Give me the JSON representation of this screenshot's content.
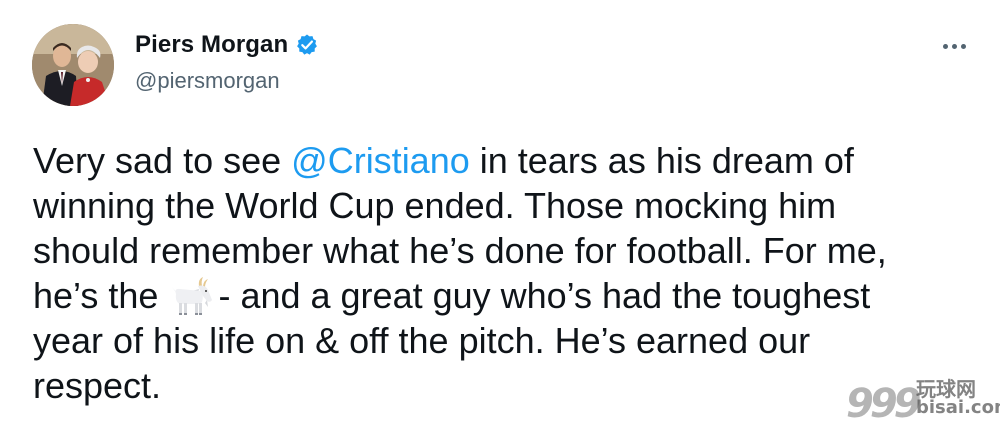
{
  "tweet": {
    "author": {
      "display_name": "Piers Morgan",
      "handle": "@piersmorgan",
      "verified_color": "#1d9bf0"
    },
    "more_icon": "more-horizontal-icon",
    "text_lines": [
      {
        "before": "Very sad to see ",
        "mention": "@Cristiano",
        "after": " in tears as his dream of"
      },
      {
        "text": "winning the World Cup ended. Those mocking him"
      },
      {
        "text": "should remember what he’s done for football. For me,"
      },
      {
        "before": "he’s the ",
        "emoji": "goat-emoji",
        "after": "- and a great guy who’s had the toughest"
      },
      {
        "text": "year of his life on & off the pitch. He’s earned our"
      },
      {
        "text": "respect."
      }
    ],
    "mention_color": "#1d9bf0"
  },
  "watermark": {
    "digits": "999",
    "chinese": "玩球网",
    "site": "bisai.com"
  }
}
